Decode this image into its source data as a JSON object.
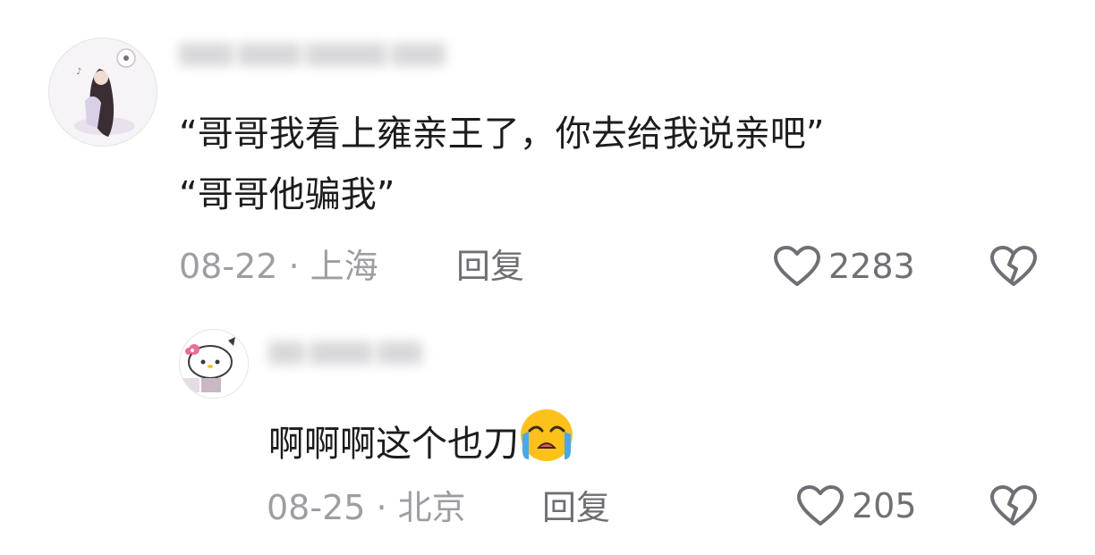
{
  "comments": [
    {
      "text_lines": [
        "“哥哥我看上雍亲王了，你去给我说亲吧”",
        "“哥哥他骗我”"
      ],
      "meta": "08-22 · 上海",
      "reply_label": "回复",
      "like_count": "2283"
    },
    {
      "text": "啊啊啊这个也刀",
      "emoji": "loudly-crying-face",
      "meta": "08-25 · 北京",
      "reply_label": "回复",
      "like_count": "205"
    }
  ],
  "colors": {
    "text": "#1c1c1e",
    "meta": "#9d9da3",
    "action": "#6f6f75"
  }
}
